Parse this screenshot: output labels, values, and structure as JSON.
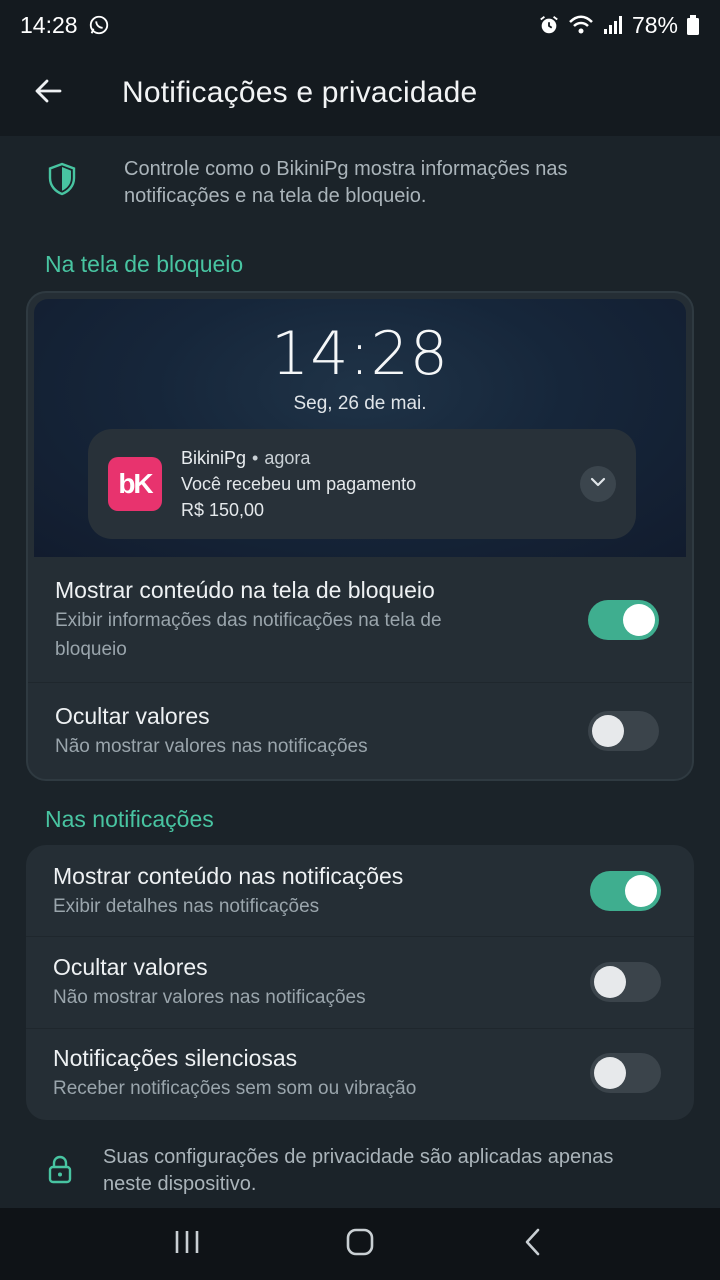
{
  "status": {
    "time": "14:28",
    "battery": "78%",
    "icons": [
      "whatsapp-icon",
      "alarm-icon",
      "wifi-icon",
      "signal-icon",
      "battery-icon"
    ]
  },
  "appbar": {
    "title": "Notificações e privacidade",
    "back_icon": "arrow-left-icon"
  },
  "intro": {
    "text": "Controle como o BikiniPg mostra informações nas notificações e na tela de bloqueio.",
    "icon": "shield-icon"
  },
  "lockscreen_section": {
    "title": "Na tela de bloqueio",
    "preview": {
      "clock": "14:28",
      "date": "Seg, 26 de mai.",
      "notification": {
        "logo": "bK",
        "app": "BikiniPg",
        "separator": "•",
        "time": "agora",
        "message": "Você recebeu um pagamento",
        "amount": "R$ 150,00"
      }
    },
    "rows": [
      {
        "title": "Mostrar conteúdo na tela de bloqueio",
        "subtitle": "Exibir informações das notificações na tela de bloqueio",
        "enabled": true
      },
      {
        "title": "Ocultar valores",
        "subtitle": "Não mostrar valores nas notificações",
        "enabled": false
      }
    ]
  },
  "notifications_section": {
    "title": "Nas notificações",
    "rows": [
      {
        "title": "Mostrar conteúdo nas notificações",
        "subtitle": "Exibir detalhes nas notificações",
        "enabled": true
      },
      {
        "title": "Ocultar valores",
        "subtitle": "Não mostrar valores nas notificações",
        "enabled": false
      },
      {
        "title": "Notificações silenciosas",
        "subtitle": "Receber notificações sem som ou vibração",
        "enabled": false
      }
    ]
  },
  "footer": {
    "text": "Suas configurações de privacidade são aplicadas apenas neste dispositivo.",
    "icon": "lock-icon"
  },
  "colors": {
    "accent": "#48c4a1",
    "toggle_on": "#3fae8f",
    "background": "#1b2329",
    "card": "#252e35",
    "brand": "#e8336e"
  },
  "navbar": {
    "buttons": [
      "recents-icon",
      "home-icon",
      "back-icon"
    ]
  }
}
